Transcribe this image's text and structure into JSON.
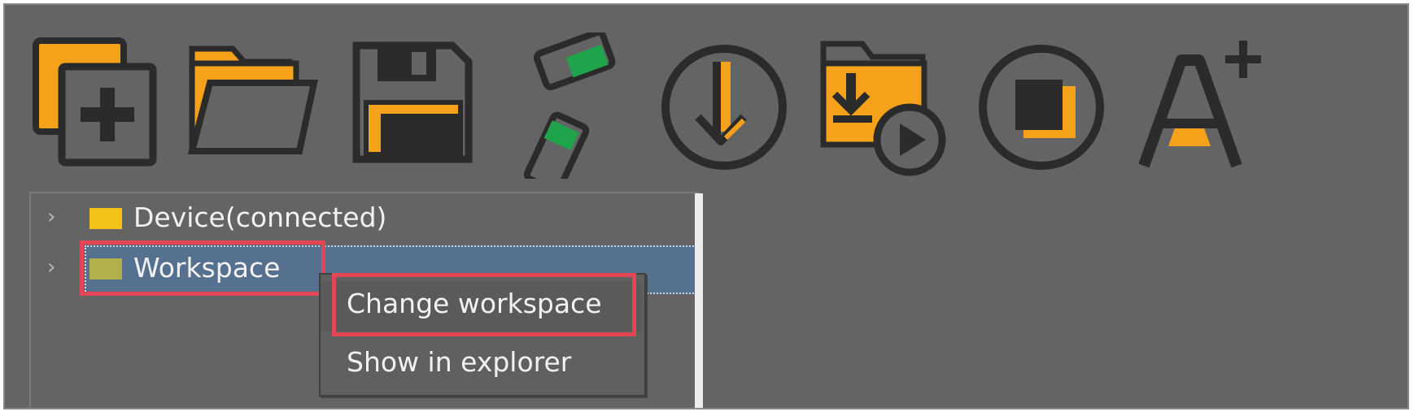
{
  "toolbar": {
    "items": [
      {
        "name": "new-project",
        "icon": "new-project-icon"
      },
      {
        "name": "open-project",
        "icon": "open-folder-icon"
      },
      {
        "name": "save",
        "icon": "save-icon"
      },
      {
        "name": "connect",
        "icon": "connect-icon"
      },
      {
        "name": "download",
        "icon": "download-icon"
      },
      {
        "name": "download-run",
        "icon": "download-run-icon"
      },
      {
        "name": "stop",
        "icon": "stop-icon"
      },
      {
        "name": "font-size",
        "icon": "font-increase-icon"
      }
    ]
  },
  "tree": {
    "nodes": [
      {
        "label": "Device(connected)",
        "icon": "folder-icon"
      },
      {
        "label": "Workspace",
        "icon": "folder-icon"
      }
    ]
  },
  "context_menu": {
    "items": [
      {
        "label": "Change workspace"
      },
      {
        "label": "Show in explorer"
      }
    ]
  },
  "colors": {
    "background": "#646464",
    "accent_orange": "#f5a11a",
    "accent_green": "#1ea54b",
    "icon_dark": "#2b2b2b",
    "selection": "#56708f",
    "highlight_red": "#e64553",
    "folder_yellow": "#f5c21a",
    "folder_olive": "#b1b04a"
  }
}
